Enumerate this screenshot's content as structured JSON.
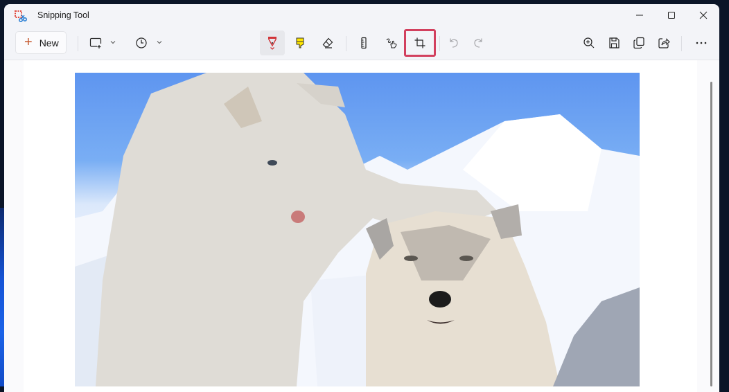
{
  "window": {
    "title": "Snipping Tool",
    "controls": [
      "minimize",
      "maximize",
      "close"
    ]
  },
  "toolbar": {
    "new_label": "New",
    "new_icon": "plus-icon",
    "left_tools": [
      {
        "name": "snip-mode",
        "icon": "rectangle-snip-icon",
        "has_dropdown": true
      },
      {
        "name": "delay",
        "icon": "clock-icon",
        "has_dropdown": true
      }
    ],
    "center_tools": [
      {
        "name": "ballpoint-pen",
        "icon": "pen-icon",
        "color": "#d13438",
        "active": true
      },
      {
        "name": "highlighter",
        "icon": "highlighter-icon",
        "color": "#ffe500"
      },
      {
        "name": "eraser",
        "icon": "eraser-icon"
      },
      {
        "name": "ruler",
        "icon": "ruler-icon"
      },
      {
        "name": "touch-writing",
        "icon": "touch-writing-icon"
      },
      {
        "name": "crop",
        "icon": "crop-icon",
        "highlighted": true
      },
      {
        "name": "undo",
        "icon": "undo-icon",
        "disabled": true
      },
      {
        "name": "redo",
        "icon": "redo-icon",
        "disabled": true
      }
    ],
    "right_tools": [
      {
        "name": "zoom",
        "icon": "zoom-in-icon"
      },
      {
        "name": "save",
        "icon": "save-icon"
      },
      {
        "name": "copy",
        "icon": "copy-icon"
      },
      {
        "name": "share",
        "icon": "share-icon"
      },
      {
        "name": "more",
        "icon": "more-icon"
      }
    ],
    "highlight_color": "#d2405e"
  },
  "canvas": {
    "image_description": "Two husky puppies in the snow; one rests its paw on the other's head, blue sky background"
  }
}
